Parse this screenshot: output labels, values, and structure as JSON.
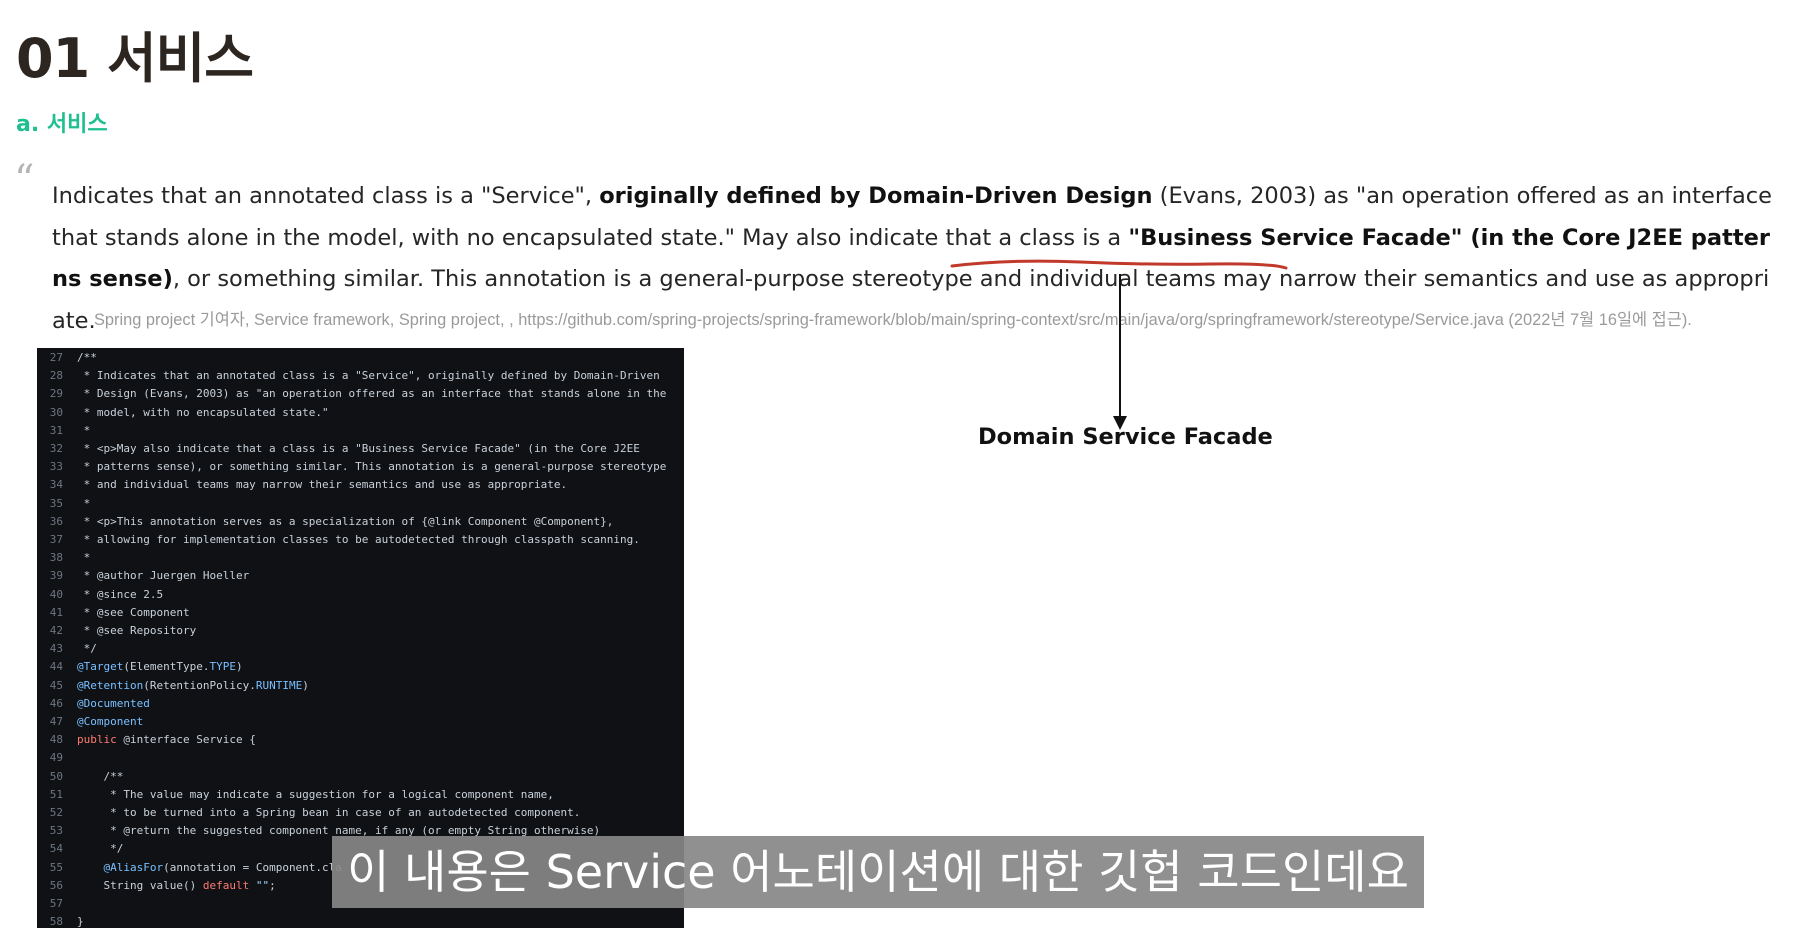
{
  "heading": {
    "title": "01 서비스",
    "subtitle": "a. 서비스"
  },
  "quote": {
    "mark": "“",
    "part1": "Indicates that an annotated class is a \"Service\", ",
    "bold1": "originally defined by Domain-Driven Design",
    "part2": " (Evans, 2003) as \"an operation offered as an interface that stands alone in the model, with no encapsulated state.\" May also indicate that a class is a ",
    "bold2": "\"Business Service Facade\" (in the Core J2EE patterns sense)",
    "part3": ", or something similar. This annotation is a general-purpose stereotype and individual teams may narrow their semantics and use as appropriate."
  },
  "citation": "Spring project 기여자, Service framework, Spring project, , https://github.com/spring-projects/spring-framework/blob/main/spring-context/src/main/java/org/springframework/stereotype/Service.java (2022년 7월 16일에 접근).",
  "annotation": {
    "label": "Domain Service Facade",
    "underline_color": "#c0392b"
  },
  "code": {
    "lines": [
      {
        "n": "27",
        "text": "/**"
      },
      {
        "n": "28",
        "text": " * Indicates that an annotated class is a \"Service\", originally defined by Domain-Driven"
      },
      {
        "n": "29",
        "text": " * Design (Evans, 2003) as \"an operation offered as an interface that stands alone in the"
      },
      {
        "n": "30",
        "text": " * model, with no encapsulated state.\""
      },
      {
        "n": "31",
        "text": " *"
      },
      {
        "n": "32",
        "text": " * <p>May also indicate that a class is a \"Business Service Facade\" (in the Core J2EE"
      },
      {
        "n": "33",
        "text": " * patterns sense), or something similar. This annotation is a general-purpose stereotype"
      },
      {
        "n": "34",
        "text": " * and individual teams may narrow their semantics and use as appropriate."
      },
      {
        "n": "35",
        "text": " *"
      },
      {
        "n": "36",
        "text": " * <p>This annotation serves as a specialization of {@link Component @Component},"
      },
      {
        "n": "37",
        "text": " * allowing for implementation classes to be autodetected through classpath scanning."
      },
      {
        "n": "38",
        "text": " *"
      },
      {
        "n": "39",
        "text": " * @author Juergen Hoeller"
      },
      {
        "n": "40",
        "text": " * @since 2.5"
      },
      {
        "n": "41",
        "text": " * @see Component"
      },
      {
        "n": "42",
        "text": " * @see Repository"
      },
      {
        "n": "43",
        "text": " */"
      },
      {
        "n": "44",
        "pre": "",
        "ann": "@Target",
        "text": "(ElementType.",
        "const": "TYPE",
        "post": ")"
      },
      {
        "n": "45",
        "pre": "",
        "ann": "@Retention",
        "text": "(RetentionPolicy.",
        "const": "RUNTIME",
        "post": ")"
      },
      {
        "n": "46",
        "ann": "@Documented",
        "text": ""
      },
      {
        "n": "47",
        "ann": "@Component",
        "text": ""
      },
      {
        "n": "48",
        "kw": "public",
        "text": " @interface Service {"
      },
      {
        "n": "49",
        "text": ""
      },
      {
        "n": "50",
        "text": "    /**"
      },
      {
        "n": "51",
        "text": "     * The value may indicate a suggestion for a logical component name,"
      },
      {
        "n": "52",
        "text": "     * to be turned into a Spring bean in case of an autodetected component."
      },
      {
        "n": "53",
        "text": "     * @return the suggested component name, if any (or empty String otherwise)"
      },
      {
        "n": "54",
        "text": "     */"
      },
      {
        "n": "55",
        "pre": "    ",
        "ann": "@AliasFor",
        "text": "(annotation = Component.cla"
      },
      {
        "n": "56",
        "pre": "    ",
        "text": "String value() ",
        "kw2": "default",
        "str": " \"\"",
        "post": ";"
      },
      {
        "n": "57",
        "text": ""
      },
      {
        "n": "58",
        "text": "}"
      }
    ]
  },
  "caption": "이 내용은 Service 어노테이션에 대한 깃헙 코드인데요"
}
